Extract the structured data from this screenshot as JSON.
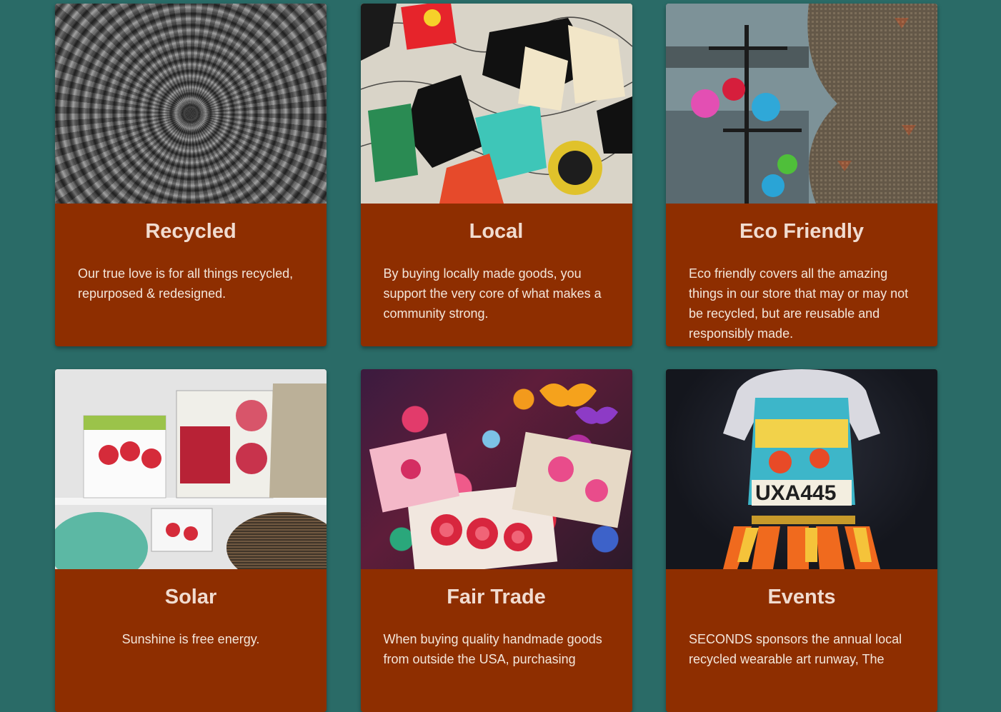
{
  "theme": {
    "page_background": "#2a6b67",
    "card_background": "#8e2e00",
    "card_text": "#f3e6da"
  },
  "cards": [
    {
      "title": "Recycled",
      "text": "Our true love is for all things recycled, repurposed & redesigned.",
      "image": "bike-chain-spiral-photo"
    },
    {
      "title": "Local",
      "text": "By buying locally made goods, you support the very core of what makes a community strong.",
      "image": "local-stickers-collage-photo"
    },
    {
      "title": "Eco Friendly",
      "text": "Eco friendly covers all the amazing things in our store that may or may not be recycled, but are reusable and responsibly made.",
      "image": "glass-vases-basket-photo"
    },
    {
      "title": "Solar",
      "text": "Sunshine is free energy.",
      "image": "solar-products-shelf-photo"
    },
    {
      "title": "Fair Trade",
      "text": "When buying quality handmade goods from outside the USA, purchasing",
      "image": "embroidered-textiles-photo"
    },
    {
      "title": "Events",
      "text": "SECONDS sponsors the annual local recycled wearable art runway, The",
      "image": "wearable-art-outfit-photo"
    }
  ]
}
